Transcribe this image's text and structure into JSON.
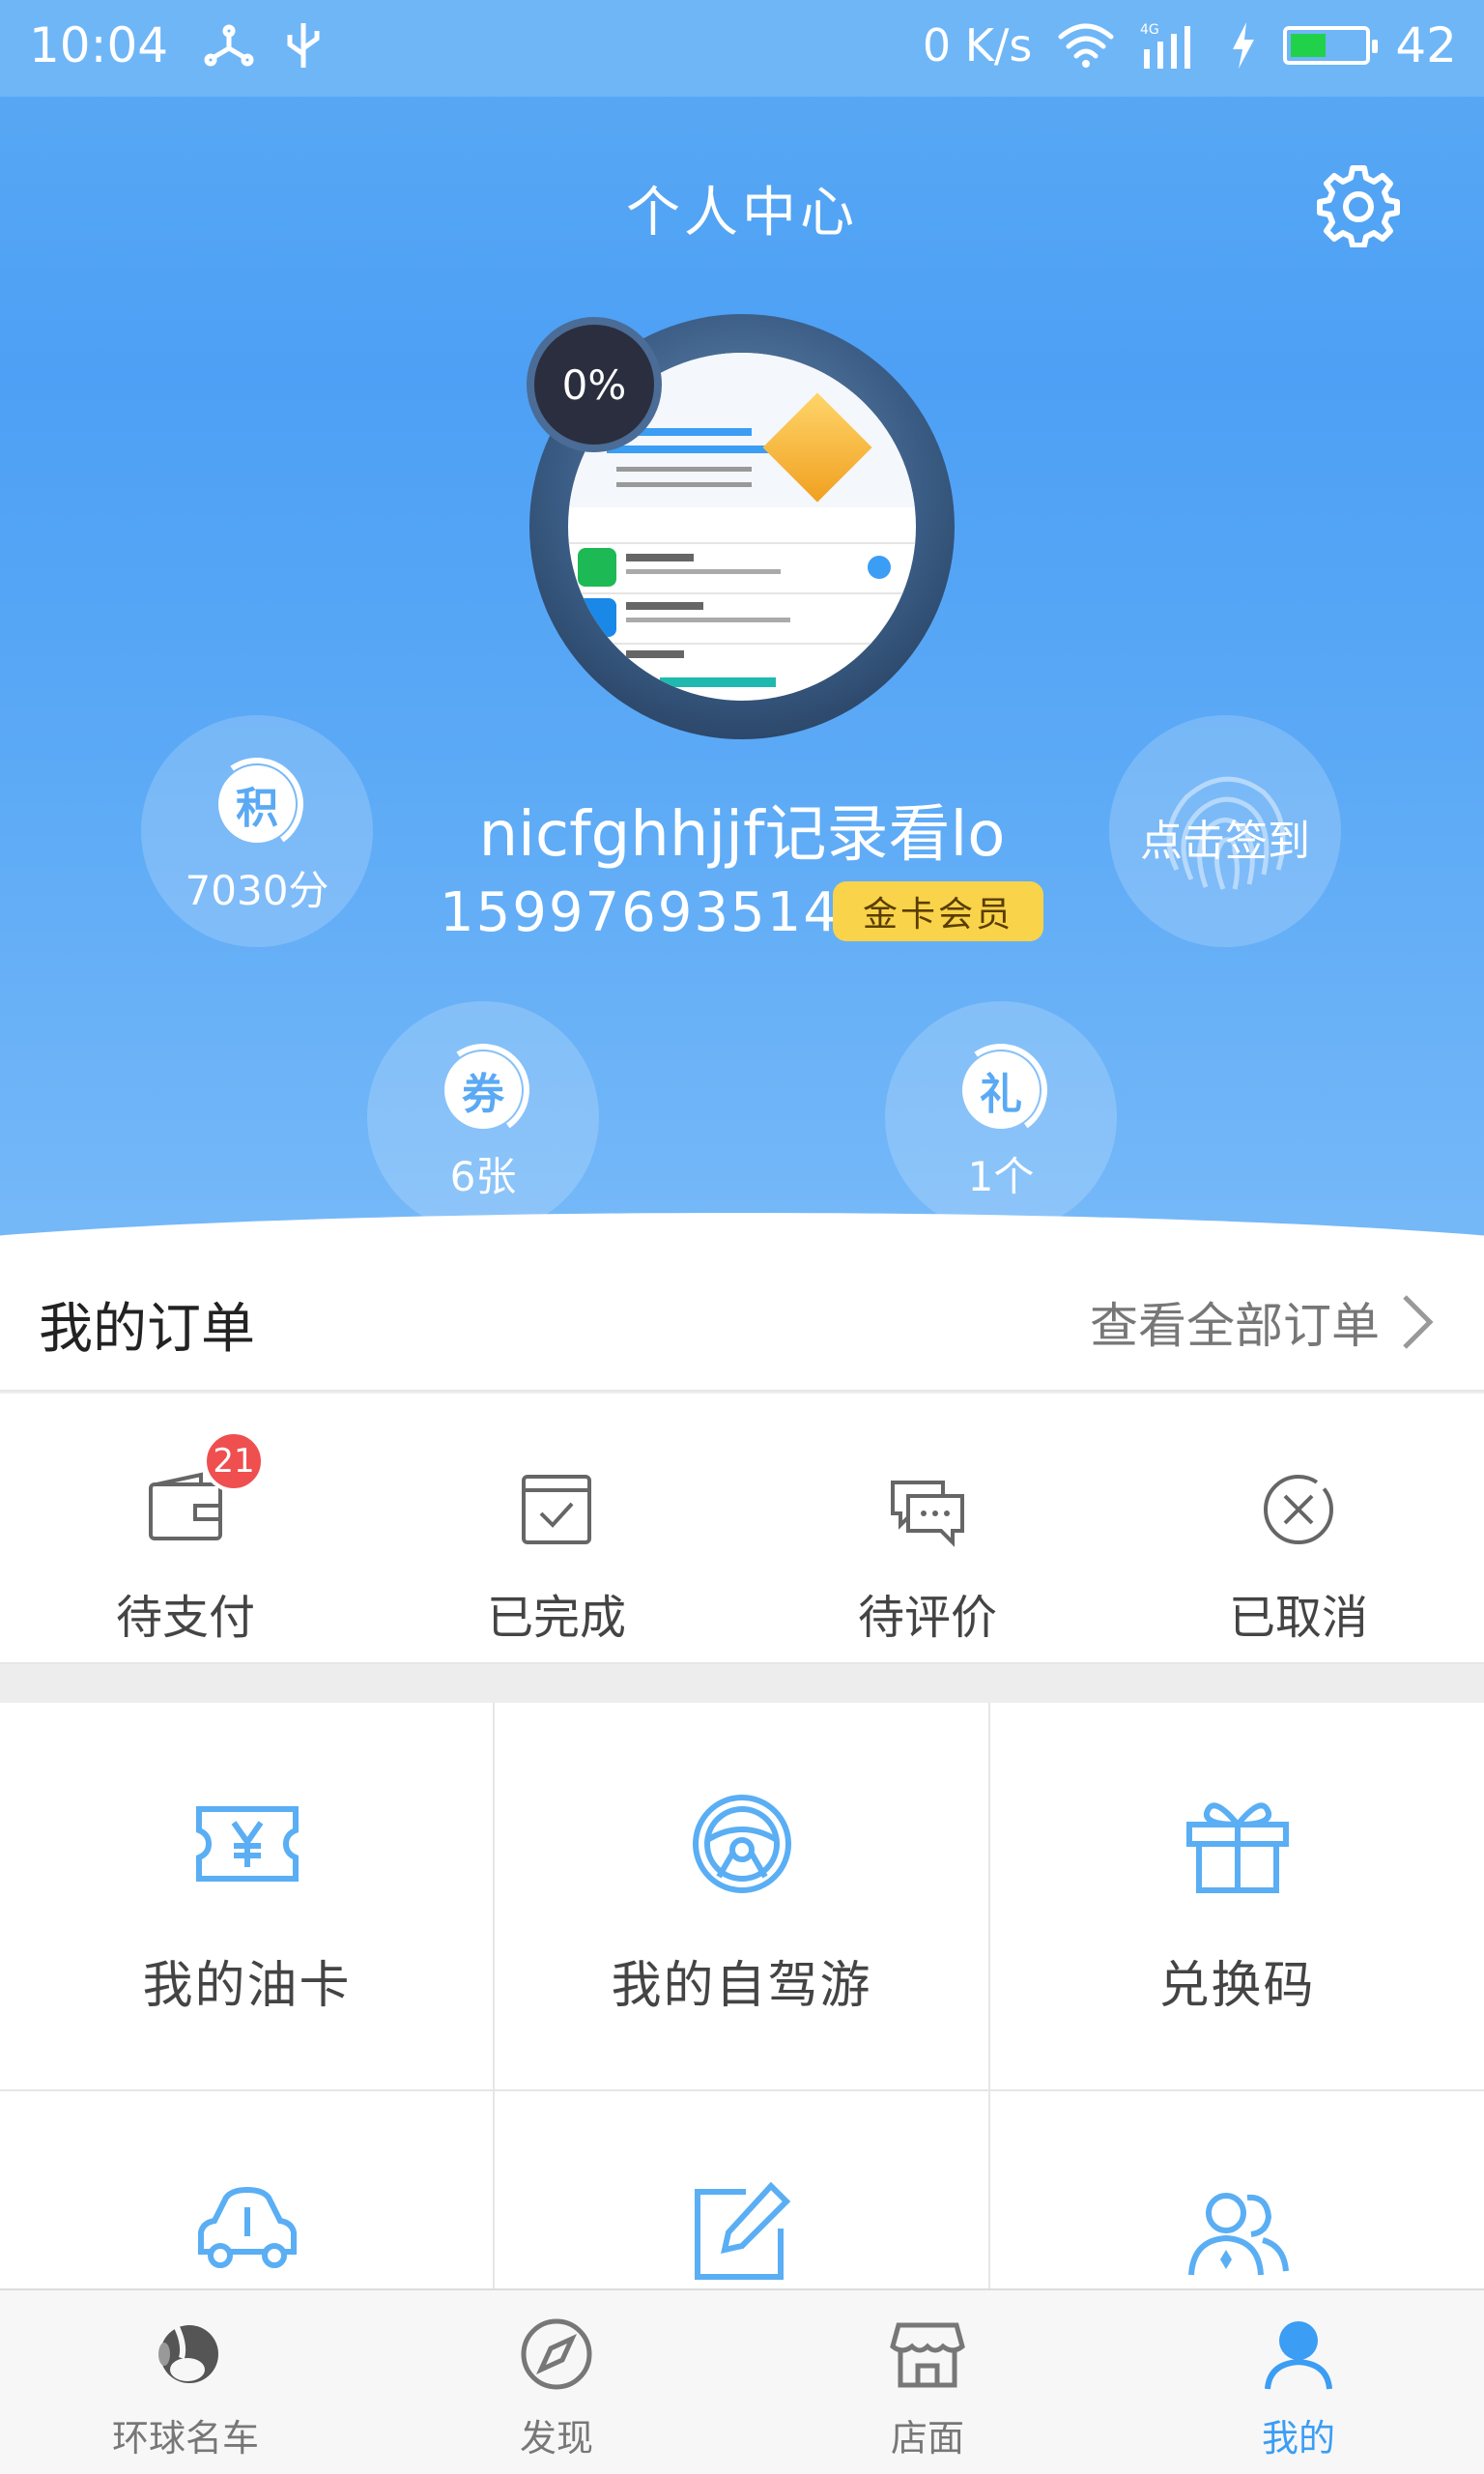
{
  "status_bar": {
    "time": "10:04",
    "net_speed": "0 K/s",
    "network": "4G",
    "battery": "42"
  },
  "header": {
    "title": "个人中心"
  },
  "profile": {
    "progress": "0%",
    "username": "nicfghhjjf记录看lo",
    "phone": "15997693514",
    "member_level": "金卡会员",
    "points_icon": "积",
    "points": "7030分",
    "coupons_icon": "券",
    "coupons": "6张",
    "gifts_icon": "礼",
    "gifts": "1个",
    "signin_label": "点击签到"
  },
  "orders": {
    "title": "我的订单",
    "view_all": "查看全部订单",
    "items": [
      {
        "label": "待支付",
        "badge": "21",
        "icon": "wallet-icon"
      },
      {
        "label": "已完成",
        "icon": "calendar-check-icon"
      },
      {
        "label": "待评价",
        "icon": "chat-icon"
      },
      {
        "label": "已取消",
        "icon": "cancel-icon"
      }
    ]
  },
  "services": [
    {
      "label": "我的油卡",
      "icon": "ticket-yuan-icon"
    },
    {
      "label": "我的自驾游",
      "icon": "steering-wheel-icon"
    },
    {
      "label": "兑换码",
      "icon": "gift-icon"
    },
    {
      "label": "",
      "icon": "car-icon"
    },
    {
      "label": "",
      "icon": "edit-icon"
    },
    {
      "label": "",
      "icon": "users-icon"
    }
  ],
  "tabs": [
    {
      "label": "环球名车",
      "icon": "brand-icon"
    },
    {
      "label": "发现",
      "icon": "compass-icon"
    },
    {
      "label": "店面",
      "icon": "store-icon"
    },
    {
      "label": "我的",
      "icon": "user-icon",
      "active": true
    }
  ],
  "colors": {
    "accent": "#3b9df4",
    "badge": "#ef4f4f",
    "member": "#f9d34a"
  }
}
